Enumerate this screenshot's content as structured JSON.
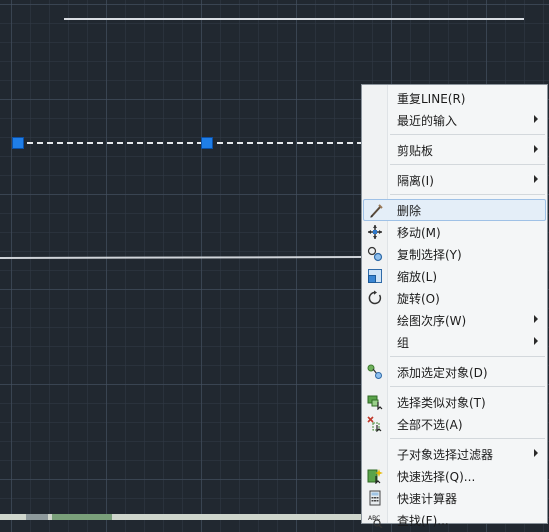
{
  "menu": {
    "items": [
      {
        "id": "repeat-line",
        "label": "重复LINE(R)"
      },
      {
        "id": "recent-input",
        "label": "最近的输入",
        "submenu": true
      },
      {
        "id": "clipboard",
        "label": "剪贴板",
        "submenu": true
      },
      {
        "id": "isolate",
        "label": "隔离(I)",
        "submenu": true
      },
      {
        "id": "erase",
        "label": "删除",
        "icon": "eraser-icon",
        "highlighted": true
      },
      {
        "id": "move",
        "label": "移动(M)",
        "icon": "move-icon"
      },
      {
        "id": "copy-selection",
        "label": "复制选择(Y)",
        "icon": "copy-icon"
      },
      {
        "id": "scale",
        "label": "缩放(L)",
        "icon": "scale-icon"
      },
      {
        "id": "rotate",
        "label": "旋转(O)",
        "icon": "rotate-icon"
      },
      {
        "id": "draw-order",
        "label": "绘图次序(W)",
        "submenu": true
      },
      {
        "id": "group",
        "label": "组",
        "submenu": true
      },
      {
        "id": "add-selected",
        "label": "添加选定对象(D)",
        "icon": "add-selected-icon"
      },
      {
        "id": "select-similar",
        "label": "选择类似对象(T)",
        "icon": "select-similar-icon"
      },
      {
        "id": "deselect-all",
        "label": "全部不选(A)",
        "icon": "deselect-all-icon"
      },
      {
        "id": "subobject-filter",
        "label": "子对象选择过滤器",
        "submenu": true
      },
      {
        "id": "quick-select",
        "label": "快速选择(Q)...",
        "icon": "quick-select-icon"
      },
      {
        "id": "quick-calc",
        "label": "快速计算器",
        "icon": "calculator-icon"
      },
      {
        "id": "find",
        "label": "查找(F)...",
        "icon": "find-icon"
      }
    ]
  },
  "colors": {
    "canvas_bg": "#212830",
    "grip": "#1f7ee8",
    "menu_bg": "#f4f6f7",
    "highlight": "#e4eef8"
  }
}
